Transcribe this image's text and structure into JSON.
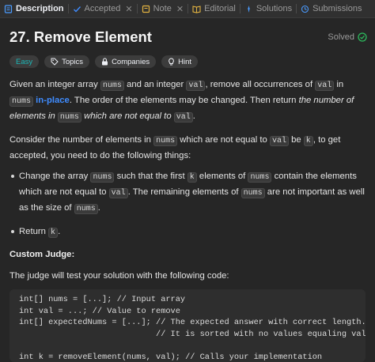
{
  "tabs": [
    {
      "label": "Description",
      "icon": "description-icon",
      "active": true
    },
    {
      "label": "Accepted",
      "icon": "accepted-icon",
      "closable": true
    },
    {
      "label": "Note",
      "icon": "note-icon",
      "closable": true
    },
    {
      "label": "Editorial",
      "icon": "editorial-icon"
    },
    {
      "label": "Solutions",
      "icon": "solutions-icon"
    },
    {
      "label": "Submissions",
      "icon": "submissions-icon"
    }
  ],
  "problem": {
    "title": "27. Remove Element",
    "status": "Solved",
    "tags": [
      "Easy",
      "Topics",
      "Companies",
      "Hint"
    ],
    "p1": {
      "t1": "Given an integer array ",
      "c1": "nums",
      "t2": " and an integer ",
      "c2": "val",
      "t3": ", remove all occurrences of ",
      "c3": "val",
      "t4": " in ",
      "c4": "nums",
      "t5": " ",
      "link": "in-place",
      "t6": ". The order of the elements may be changed. Then return ",
      "em1": "the number of elements in ",
      "c5": "nums",
      "em2": " which are not equal to ",
      "c6": "val",
      "t7": "."
    },
    "p2": {
      "t1": "Consider the number of elements in ",
      "c1": "nums",
      "t2": " which are not equal to ",
      "c2": "val",
      "t3": " be ",
      "c3": "k",
      "t4": ", to get accepted, you need to do the following things:"
    },
    "b1": {
      "t1": "Change the array ",
      "c1": "nums",
      "t2": " such that the first ",
      "c2": "k",
      "t3": " elements of ",
      "c3": "nums",
      "t4": " contain the elements which are not equal to ",
      "c4": "val",
      "t5": ". The remaining elements of ",
      "c5": "nums",
      "t6": " are not important as well as the size of ",
      "c6": "nums",
      "t7": "."
    },
    "b2": {
      "t1": "Return ",
      "c1": "k",
      "t2": "."
    },
    "judge_heading": "Custom Judge:",
    "judge_desc": "The judge will test your solution with the following code:",
    "code": [
      "int[] nums = [...]; // Input array",
      "int val = ...; // Value to remove",
      "int[] expectedNums = [...]; // The expected answer with correct length.",
      "                            // It is sorted with no values equaling val.",
      "",
      "int k = removeElement(nums, val); // Calls your implementation"
    ]
  },
  "colors": {
    "background": "#262626",
    "easy": "#1cb8b8",
    "link": "#3f8cff",
    "solved_check": "#2cbb5d"
  }
}
